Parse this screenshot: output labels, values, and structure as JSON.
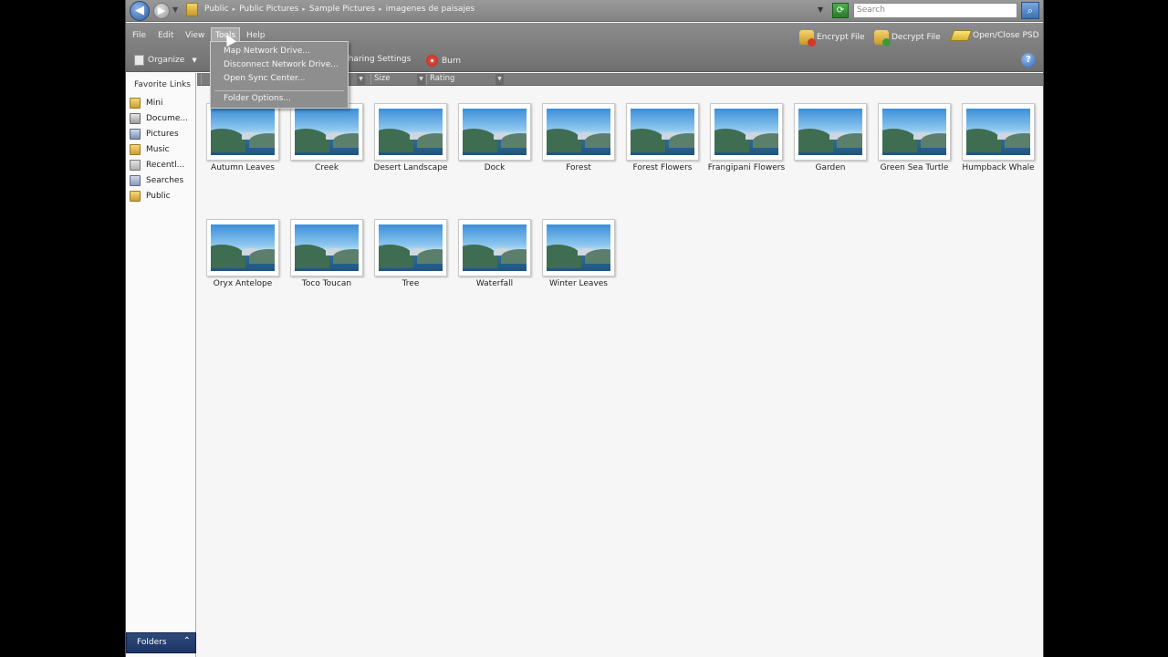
{
  "address_bar": {
    "breadcrumbs": [
      "Public",
      "Public Pictures",
      "Sample Pictures",
      "imagenes de paisajes"
    ],
    "search_placeholder": "Search"
  },
  "menu": {
    "items": [
      "File",
      "Edit",
      "View",
      "Tools",
      "Help"
    ],
    "open_menu": "Tools",
    "tools_dropdown": [
      "Map Network Drive...",
      "Disconnect Network Drive...",
      "Open Sync Center...",
      "Folder Options..."
    ]
  },
  "right_tools": {
    "encrypt": "Encrypt File",
    "decrypt": "Decrypt File",
    "psd": "Open/Close PSD"
  },
  "toolbar": {
    "organize": "Organize",
    "sharing": "Sharing Settings",
    "burn": "Burn"
  },
  "columns": [
    "Size",
    "Rating"
  ],
  "sidebar": {
    "title": "Favorite Links",
    "items": [
      {
        "label": "Mini",
        "icon": "folder-icon"
      },
      {
        "label": "Docume...",
        "icon": "documents-icon"
      },
      {
        "label": "Pictures",
        "icon": "pictures-icon"
      },
      {
        "label": "Music",
        "icon": "music-icon"
      },
      {
        "label": "Recentl...",
        "icon": "recent-icon"
      },
      {
        "label": "Searches",
        "icon": "searches-icon"
      },
      {
        "label": "Public",
        "icon": "folder-icon"
      }
    ],
    "folders_label": "Folders"
  },
  "files": [
    "Autumn Leaves",
    "Creek",
    "Desert Landscape",
    "Dock",
    "Forest",
    "Forest Flowers",
    "Frangipani Flowers",
    "Garden",
    "Green Sea Turtle",
    "Humpback Whale",
    "Oryx Antelope",
    "Toco Toucan",
    "Tree",
    "Waterfall",
    "Winter Leaves"
  ]
}
